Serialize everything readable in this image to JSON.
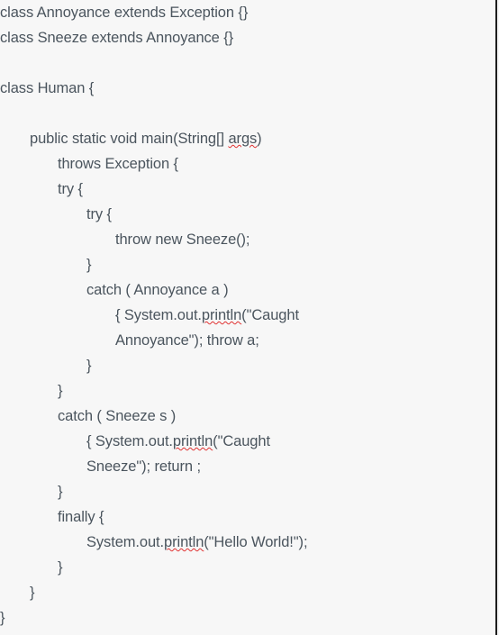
{
  "document": {
    "type": "code-document",
    "language": "Java",
    "background_color": "#f7f7f7",
    "text_color": "#4b555e",
    "spellcheck_underline_color": "#e03131",
    "right_margin_rule_color": "#1d1d1d"
  },
  "code": {
    "lines": [
      {
        "id": "l1",
        "indent": 0,
        "text": "class Annoyance extends Exception {}"
      },
      {
        "id": "l2",
        "indent": 0,
        "text": "class Sneeze extends Annoyance {}"
      },
      {
        "id": "l3",
        "indent": 0,
        "text": ""
      },
      {
        "id": "l4",
        "indent": 0,
        "text": "class Human {"
      },
      {
        "id": "l5",
        "indent": 0,
        "text": ""
      },
      {
        "id": "l6",
        "indent": 1,
        "pre": "public static void main(String[] ",
        "misspelled": "args",
        "post": ")"
      },
      {
        "id": "l7",
        "indent": 2,
        "text": "throws Exception {"
      },
      {
        "id": "l8",
        "indent": 2,
        "text": "try {"
      },
      {
        "id": "l9",
        "indent": 3,
        "text": "try {"
      },
      {
        "id": "l10",
        "indent": 4,
        "text": "throw new Sneeze();"
      },
      {
        "id": "l11",
        "indent": 3,
        "text": "}"
      },
      {
        "id": "l12",
        "indent": 3,
        "pre": "catch ( Annoyance a )",
        "misspelled": "",
        "post": ""
      },
      {
        "id": "l13",
        "indent": 4,
        "pre": "{ System.out.",
        "misspelled": "println",
        "post": "(\"Caught"
      },
      {
        "id": "l14",
        "indent": 4,
        "text": "Annoyance\"); throw a;"
      },
      {
        "id": "l15",
        "indent": 3,
        "text": "}"
      },
      {
        "id": "l16",
        "indent": 2,
        "text": "}"
      },
      {
        "id": "l17",
        "indent": 2,
        "text": "catch ( Sneeze s )"
      },
      {
        "id": "l18",
        "indent": 3,
        "pre": "{ System.out.",
        "misspelled": "println",
        "post": "(\"Caught"
      },
      {
        "id": "l19",
        "indent": 3,
        "text": "Sneeze\"); return ;"
      },
      {
        "id": "l20",
        "indent": 2,
        "text": "}"
      },
      {
        "id": "l21",
        "indent": 2,
        "text": "finally {"
      },
      {
        "id": "l22",
        "indent": 3,
        "pre": "System.out.",
        "misspelled": "println",
        "post": "(\"Hello World!\");"
      },
      {
        "id": "l23",
        "indent": 2,
        "text": "}"
      },
      {
        "id": "l24",
        "indent": 1,
        "text": "}"
      },
      {
        "id": "l25",
        "indent": 0,
        "text": "}"
      }
    ]
  }
}
